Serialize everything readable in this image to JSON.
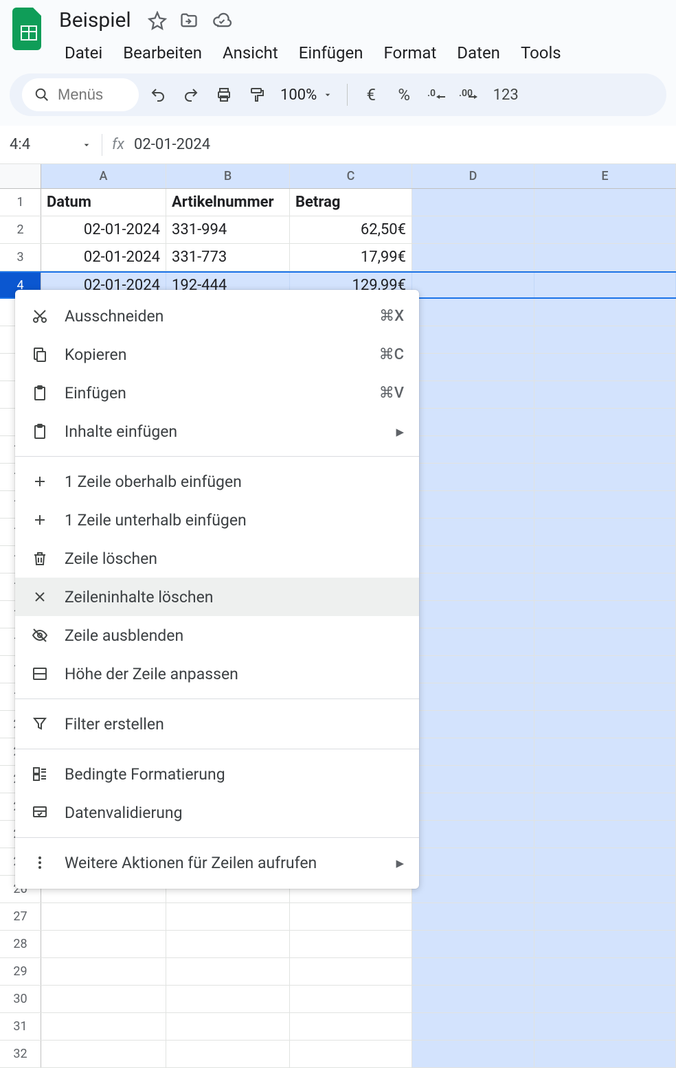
{
  "doc": {
    "title": "Beispiel"
  },
  "menubar": [
    "Datei",
    "Bearbeiten",
    "Ansicht",
    "Einfügen",
    "Format",
    "Daten",
    "Tools"
  ],
  "toolbar": {
    "search_placeholder": "Menüs",
    "zoom": "100%",
    "currency": "€",
    "percent": "%",
    "number_fmt": "123"
  },
  "namebox": {
    "ref": "4:4",
    "formula": "02-01-2024"
  },
  "columns": [
    "A",
    "B",
    "C",
    "D",
    "E"
  ],
  "headers": {
    "A": "Datum",
    "B": "Artikelnummer",
    "C": "Betrag"
  },
  "rows": [
    {
      "n": "1",
      "A": "Datum",
      "B": "Artikelnummer",
      "C": "Betrag",
      "bold": true
    },
    {
      "n": "2",
      "A": "02-01-2024",
      "B": "331-994",
      "C": "62,50€"
    },
    {
      "n": "3",
      "A": "02-01-2024",
      "B": "331-773",
      "C": "17,99€"
    },
    {
      "n": "4",
      "A": "02-01-2024",
      "B": "192-444",
      "C": "129,99€",
      "selected": true
    }
  ],
  "empty_row_count": 28,
  "context_menu": {
    "cut": {
      "label": "Ausschneiden",
      "shortcut": "⌘X"
    },
    "copy": {
      "label": "Kopieren",
      "shortcut": "⌘C"
    },
    "paste": {
      "label": "Einfügen",
      "shortcut": "⌘V"
    },
    "paste_special": {
      "label": "Inhalte einfügen"
    },
    "insert_above": {
      "label": "1 Zeile oberhalb einfügen"
    },
    "insert_below": {
      "label": "1 Zeile unterhalb einfügen"
    },
    "delete_row": {
      "label": "Zeile löschen"
    },
    "clear_row": {
      "label": "Zeileninhalte löschen"
    },
    "hide_row": {
      "label": "Zeile ausblenden"
    },
    "resize_row": {
      "label": "Höhe der Zeile anpassen"
    },
    "create_filter": {
      "label": "Filter erstellen"
    },
    "cond_format": {
      "label": "Bedingte Formatierung"
    },
    "data_validation": {
      "label": "Datenvalidierung"
    },
    "more_actions": {
      "label": "Weitere Aktionen für Zeilen aufrufen"
    }
  }
}
